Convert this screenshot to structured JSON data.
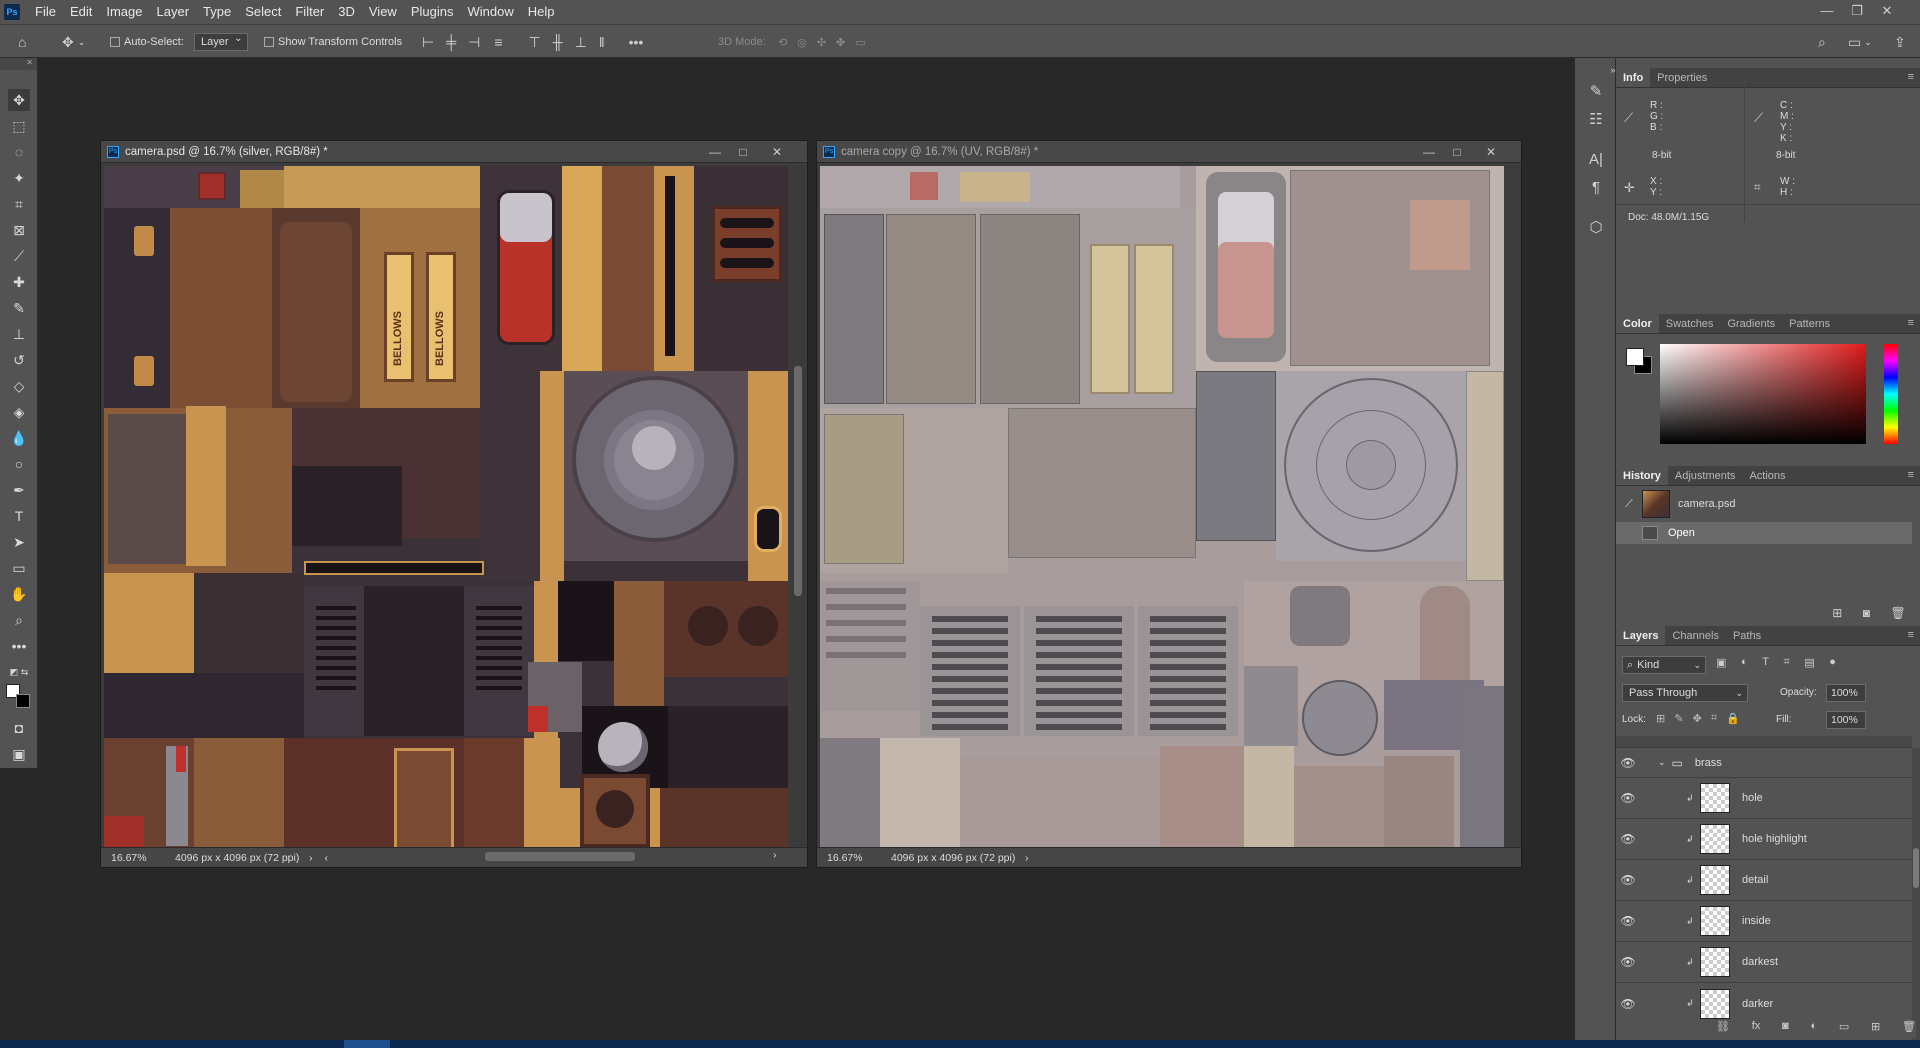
{
  "menubar": {
    "app_icon": "Ps",
    "items": [
      "File",
      "Edit",
      "Image",
      "Layer",
      "Type",
      "Select",
      "Filter",
      "3D",
      "View",
      "Plugins",
      "Window",
      "Help"
    ],
    "window_controls": [
      "minimize-icon",
      "restore-icon",
      "close-icon"
    ]
  },
  "options_bar": {
    "auto_select_label": "Auto-Select:",
    "auto_select_target": "Layer",
    "show_transform_label": "Show Transform Controls",
    "three_d_mode_label": "3D Mode:"
  },
  "documents": [
    {
      "title": "camera.psd @ 16.7% (silver, RGB/8#) *",
      "zoom": "16.67%",
      "info": "4096 px x 4096 px (72 ppi)"
    },
    {
      "title": "camera copy @ 16.7% (UV, RGB/8#) *",
      "zoom": "16.67%",
      "info": "4096 px x 4096 px (72 ppi)"
    }
  ],
  "texture_text": [
    "BELLOWS",
    "BELLOWS"
  ],
  "info_panel": {
    "tabs": [
      "Info",
      "Properties"
    ],
    "rgb_labels": [
      "R :",
      "G :",
      "B :"
    ],
    "cmyk_labels": [
      "C :",
      "M :",
      "Y :",
      "K :"
    ],
    "bit_left": "8-bit",
    "bit_right": "8-bit",
    "xy_labels": [
      "X :",
      "Y :"
    ],
    "wh_labels": [
      "W :",
      "H :"
    ],
    "doc": "Doc: 48.0M/1.15G"
  },
  "color_panel": {
    "tabs": [
      "Color",
      "Swatches",
      "Gradients",
      "Patterns"
    ],
    "foreground": "#ffffff",
    "background": "#000000",
    "hue_base": "#e01b1b"
  },
  "history_panel": {
    "tabs": [
      "History",
      "Adjustments",
      "Actions"
    ],
    "snapshot": "camera.psd",
    "steps": [
      "Open"
    ]
  },
  "layers_panel": {
    "tabs": [
      "Layers",
      "Channels",
      "Paths"
    ],
    "filter": "Kind",
    "blend_mode": "Pass Through",
    "opacity_label": "Opacity:",
    "opacity": "100%",
    "lock_label": "Lock:",
    "fill_label": "Fill:",
    "fill": "100%",
    "group": "brass",
    "layers": [
      "hole",
      "hole highlight",
      "detail",
      "inside",
      "darkest",
      "darker"
    ]
  }
}
